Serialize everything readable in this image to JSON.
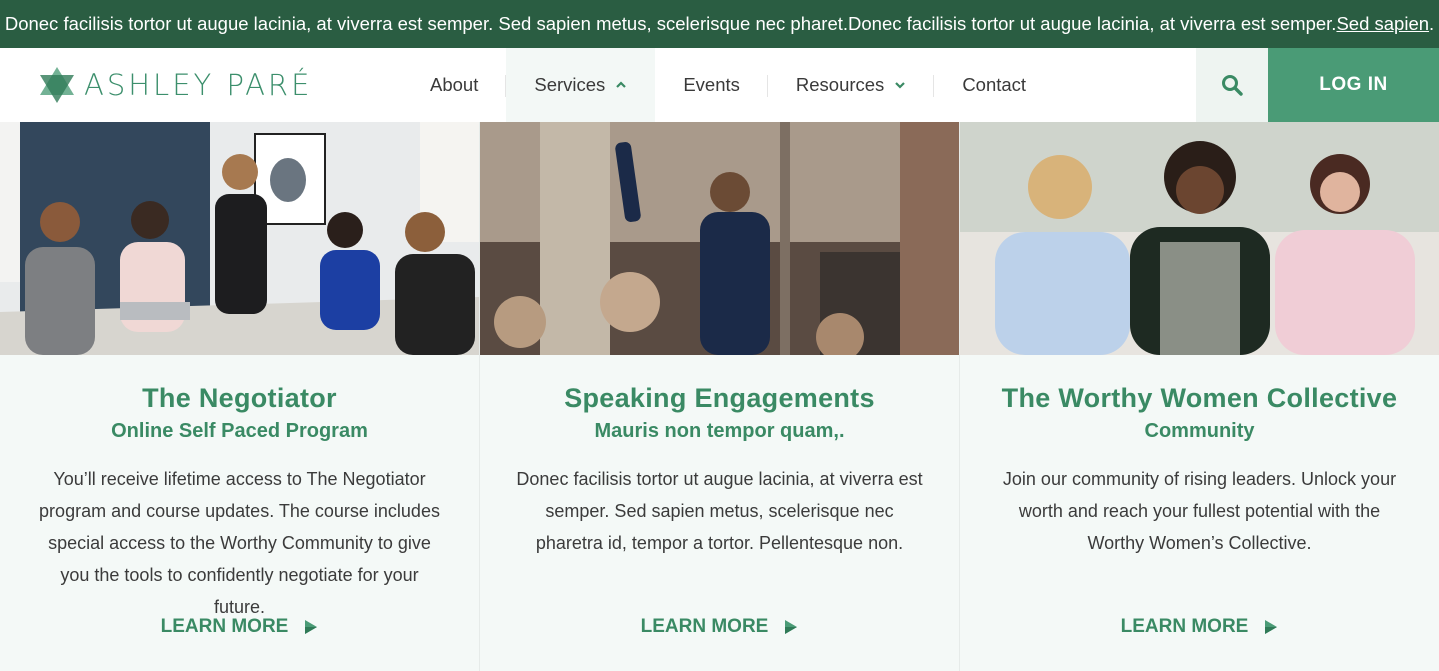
{
  "announcement": {
    "text": "Donec facilisis tortor ut augue lacinia, at viverra est semper. Sed sapien metus, scelerisque nec pharet.Donec facilisis tortor ut augue lacinia, at viverra est semper. ",
    "link": "Sed sapien",
    "trail": "."
  },
  "logo": {
    "text": "ASHLEY PARÉ",
    "icon": "star-logo-icon"
  },
  "nav": {
    "items": [
      {
        "label": "About"
      },
      {
        "label": "Services",
        "icon": "chevron-up-icon"
      },
      {
        "label": "Events"
      },
      {
        "label": "Resources",
        "icon": "chevron-down-icon"
      },
      {
        "label": "Contact"
      }
    ],
    "search_icon": "search-icon",
    "login": "LOG IN"
  },
  "cards": [
    {
      "title": "The Negotiator",
      "subtitle": "Online Self Paced Program",
      "text": "You’ll receive lifetime access to The Negotiator program and course updates.  The course includes special access to the Worthy Community to give you the tools to confidently negotiate for your future.",
      "cta": "LEARN MORE"
    },
    {
      "title": "Speaking Engagements",
      "subtitle": "Mauris non tempor quam,.",
      "text": "Donec facilisis tortor ut augue lacinia, at viverra est semper. Sed sapien metus, scelerisque nec pharetra id, tempor a tortor. Pellentesque non.",
      "cta": "LEARN MORE"
    },
    {
      "title": "The Worthy Women Collective",
      "subtitle": "Community",
      "text": "Join our community of rising leaders. Unlock your worth and reach your fullest potential with the Worthy Women’s Collective.",
      "cta": "LEARN MORE"
    }
  ],
  "colors": {
    "brand_dark": "#2a5d42",
    "brand": "#4a9b76",
    "text_green": "#3a8a64"
  }
}
